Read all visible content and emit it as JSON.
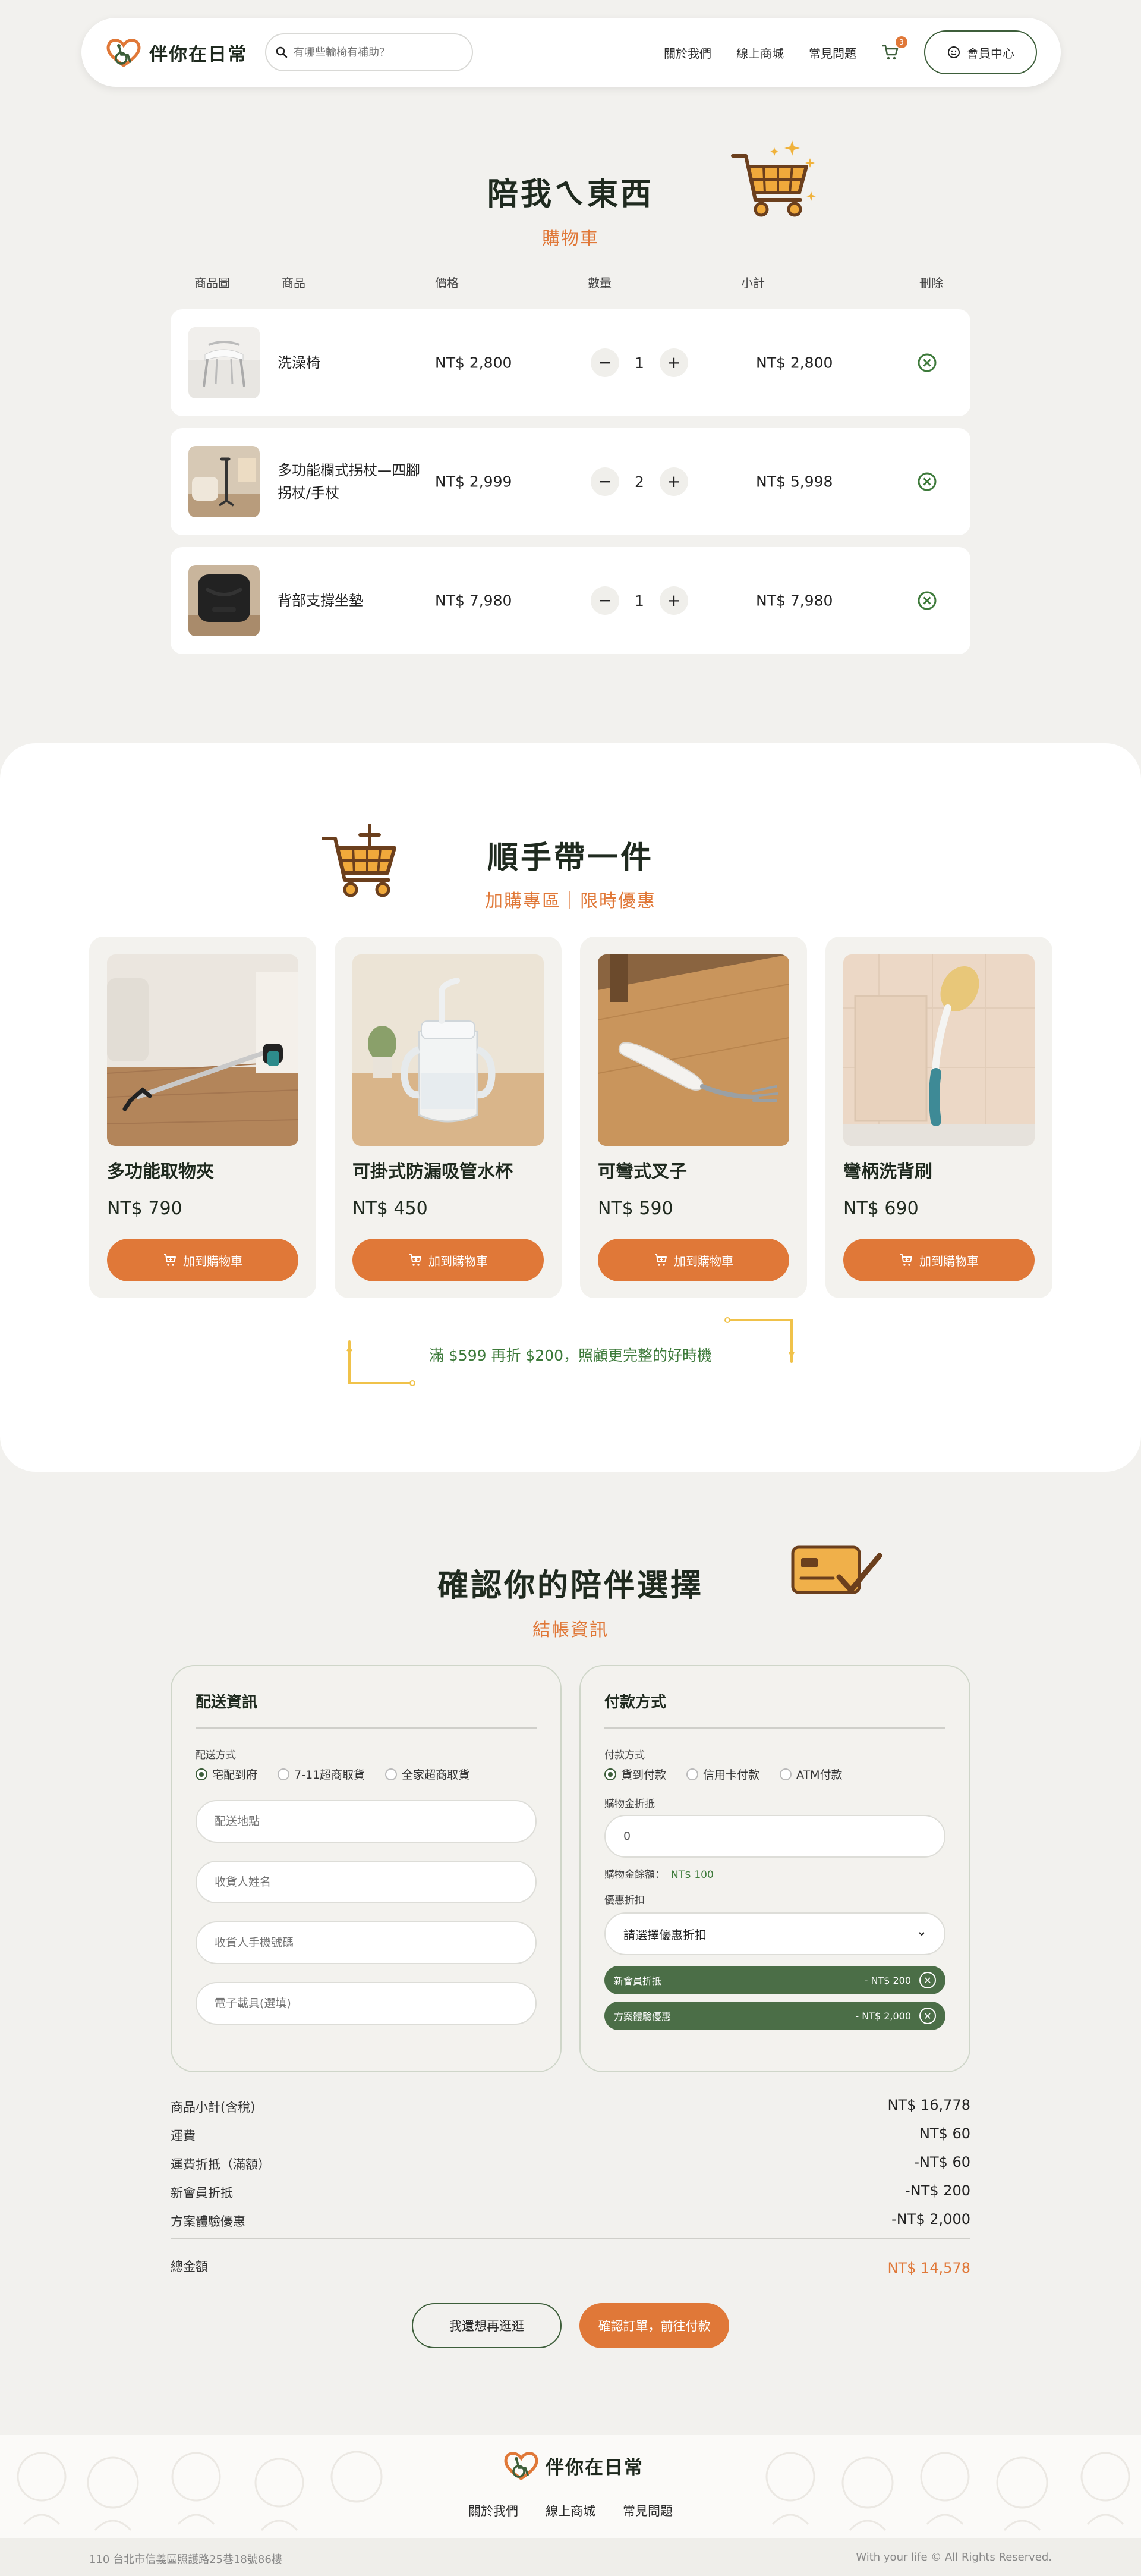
{
  "brand": {
    "name": "伴你在日常"
  },
  "search": {
    "placeholder": "有哪些輪椅有補助？"
  },
  "nav": {
    "about": "關於我們",
    "shop": "線上商城",
    "faq": "常見問題",
    "cart_count": "3",
    "member": "會員中心"
  },
  "cart": {
    "title": "陪我ㄟ東西",
    "subtitle": "購物車",
    "headers": {
      "image": "商品圖",
      "name": "商品",
      "price": "價格",
      "qty": "數量",
      "subtotal": "小計",
      "delete": "刪除"
    },
    "items": [
      {
        "name": "洗澡椅",
        "price": "NT$ 2,800",
        "qty": "1",
        "subtotal": "NT$ 2,800"
      },
      {
        "name": "多功能欄式拐杖—四腳拐杖/手杖",
        "price": "NT$ 2,999",
        "qty": "2",
        "subtotal": "NT$ 5,998"
      },
      {
        "name": "背部支撐坐墊",
        "price": "NT$ 7,980",
        "qty": "1",
        "subtotal": "NT$ 7,980"
      }
    ]
  },
  "addon": {
    "title": "順手帶一件",
    "subtitle": "加購專區｜限時優惠",
    "button_label": "加到購物車",
    "items": [
      {
        "name": "多功能取物夾",
        "price": "NT$ 790"
      },
      {
        "name": "可掛式防漏吸管水杯",
        "price": "NT$ 450"
      },
      {
        "name": "可彎式叉子",
        "price": "NT$ 590"
      },
      {
        "name": "彎柄洗背刷",
        "price": "NT$ 690"
      }
    ],
    "promo": "滿 $599 再折 $200，照顧更完整的好時機"
  },
  "checkout": {
    "title": "確認你的陪伴選擇",
    "subtitle": "結帳資訊",
    "shipping": {
      "title": "配送資訊",
      "method_label": "配送方式",
      "methods": [
        "宅配到府",
        "7-11超商取貨",
        "全家超商取貨"
      ],
      "address_placeholder": "配送地點",
      "name_placeholder": "收貨人姓名",
      "phone_placeholder": "收貨人手機號碼",
      "invoice_placeholder": "電子載具(選填)"
    },
    "payment": {
      "title": "付款方式",
      "method_label": "付款方式",
      "methods": [
        "貨到付款",
        "信用卡付款",
        "ATM付款"
      ],
      "discount_label": "購物金折抵",
      "discount_value": "0",
      "balance_label": "購物金餘額：",
      "balance_value": "NT$ 100",
      "coupon_label": "優惠折扣",
      "coupon_placeholder": "請選擇優惠折扣",
      "applied": [
        {
          "name": "新會員折抵",
          "value": "- NT$ 200"
        },
        {
          "name": "方案體驗優惠",
          "value": "- NT$ 2,000"
        }
      ]
    }
  },
  "summary": {
    "rows": [
      {
        "label": "商品小計(含稅)",
        "value": "NT$ 16,778"
      },
      {
        "label": "運費",
        "value": "NT$ 60"
      },
      {
        "label": "運費折抵（滿額）",
        "value": "-NT$ 60"
      },
      {
        "label": "新會員折抵",
        "value": "-NT$ 200"
      },
      {
        "label": "方案體驗優惠",
        "value": "-NT$ 2,000"
      }
    ],
    "total_label": "總金額",
    "total_value": "NT$ 14,578",
    "back_label": "我還想再逛逛",
    "confirm_label": "確認訂單，前往付款"
  },
  "footer": {
    "links": [
      "關於我們",
      "線上商城",
      "常見問題"
    ],
    "address": "110 台北市信義區照護路25巷18號86樓",
    "copyright": "With your life © All Rights Reserved."
  },
  "colors": {
    "accent": "#e07838",
    "brand_green": "#3d5e3a",
    "background": "#f2f1ee"
  }
}
